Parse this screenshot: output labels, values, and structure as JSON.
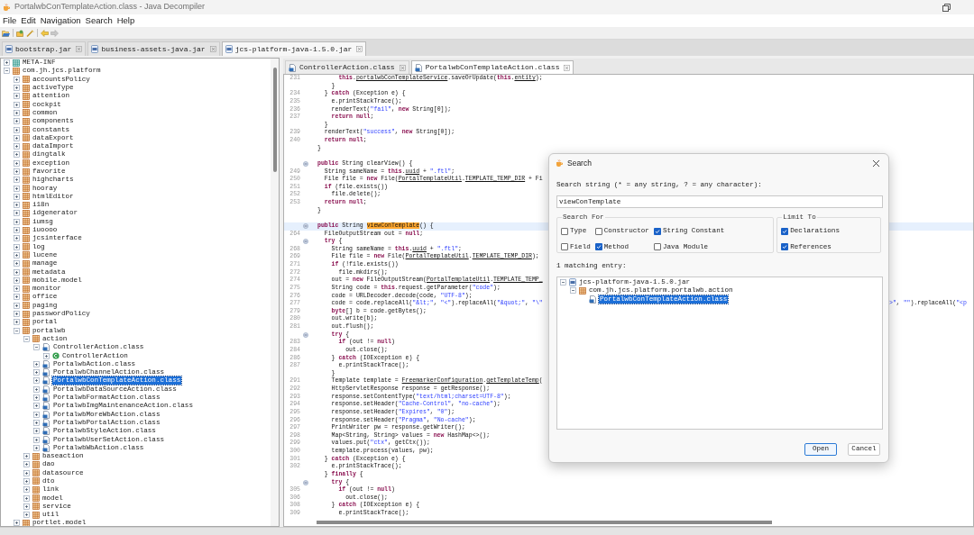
{
  "window": {
    "title": "PortalwbConTemplateAction.class - Java Decompiler"
  },
  "menu": [
    "File",
    "Edit",
    "Navigation",
    "Search",
    "Help"
  ],
  "toolbar": {
    "back_disabled": false,
    "forward_disabled": true
  },
  "jar_tabs": [
    {
      "label": "bootstrap.jar",
      "selected": false
    },
    {
      "label": "business-assets-java.jar",
      "selected": false
    },
    {
      "label": "jcs-platform-java-1.5.0.jar",
      "selected": true
    }
  ],
  "tree": [
    {
      "label": "META-INF",
      "kind": "folder",
      "expanded": false,
      "selected": false
    },
    {
      "label": "com.jh.jcs.platform",
      "kind": "package",
      "expanded": true,
      "selected": false,
      "children": [
        {
          "label": "accountsPolicy",
          "kind": "package",
          "expanded": false,
          "selected": false
        },
        {
          "label": "activeType",
          "kind": "package",
          "expanded": false,
          "selected": false
        },
        {
          "label": "attention",
          "kind": "package",
          "expanded": false,
          "selected": false
        },
        {
          "label": "cockpit",
          "kind": "package",
          "expanded": false,
          "selected": false
        },
        {
          "label": "common",
          "kind": "package",
          "expanded": false,
          "selected": false
        },
        {
          "label": "components",
          "kind": "package",
          "expanded": false,
          "selected": false
        },
        {
          "label": "constants",
          "kind": "package",
          "expanded": false,
          "selected": false
        },
        {
          "label": "dataExport",
          "kind": "package",
          "expanded": false,
          "selected": false
        },
        {
          "label": "dataImport",
          "kind": "package",
          "expanded": false,
          "selected": false
        },
        {
          "label": "dingtalk",
          "kind": "package",
          "expanded": false,
          "selected": false
        },
        {
          "label": "exception",
          "kind": "package",
          "expanded": false,
          "selected": false
        },
        {
          "label": "favorite",
          "kind": "package",
          "expanded": false,
          "selected": false
        },
        {
          "label": "highcharts",
          "kind": "package",
          "expanded": false,
          "selected": false
        },
        {
          "label": "hooray",
          "kind": "package",
          "expanded": false,
          "selected": false
        },
        {
          "label": "htmlEditor",
          "kind": "package",
          "expanded": false,
          "selected": false
        },
        {
          "label": "i18n",
          "kind": "package",
          "expanded": false,
          "selected": false
        },
        {
          "label": "idgenerator",
          "kind": "package",
          "expanded": false,
          "selected": false
        },
        {
          "label": "iumsg",
          "kind": "package",
          "expanded": false,
          "selected": false
        },
        {
          "label": "iuoooo",
          "kind": "package",
          "expanded": false,
          "selected": false
        },
        {
          "label": "jcsinterface",
          "kind": "package",
          "expanded": false,
          "selected": false
        },
        {
          "label": "log",
          "kind": "package",
          "expanded": false,
          "selected": false
        },
        {
          "label": "lucene",
          "kind": "package",
          "expanded": false,
          "selected": false
        },
        {
          "label": "manage",
          "kind": "package",
          "expanded": false,
          "selected": false
        },
        {
          "label": "metadata",
          "kind": "package",
          "expanded": false,
          "selected": false
        },
        {
          "label": "mobile.model",
          "kind": "package",
          "expanded": false,
          "selected": false
        },
        {
          "label": "monitor",
          "kind": "package",
          "expanded": false,
          "selected": false
        },
        {
          "label": "office",
          "kind": "package",
          "expanded": false,
          "selected": false
        },
        {
          "label": "paging",
          "kind": "package",
          "expanded": false,
          "selected": false
        },
        {
          "label": "passwordPolicy",
          "kind": "package",
          "expanded": false,
          "selected": false
        },
        {
          "label": "portal",
          "kind": "package",
          "expanded": false,
          "selected": false
        },
        {
          "label": "portalwb",
          "kind": "package",
          "expanded": true,
          "selected": false,
          "children": [
            {
              "label": "action",
              "kind": "package",
              "expanded": true,
              "selected": false,
              "children": [
                {
                  "label": "ControllerAction.class",
                  "kind": "class",
                  "expanded": true,
                  "selected": false,
                  "children": [
                    {
                      "label": "ControllerAction",
                      "kind": "type",
                      "expanded": false,
                      "selected": false
                    }
                  ]
                },
                {
                  "label": "PortalwbAction.class",
                  "kind": "class",
                  "expanded": false,
                  "selected": false
                },
                {
                  "label": "PortalwbChannelAction.class",
                  "kind": "class",
                  "expanded": false,
                  "selected": false
                },
                {
                  "label": "PortalwbConTemplateAction.class",
                  "kind": "class",
                  "expanded": false,
                  "selected": true
                },
                {
                  "label": "PortalwbDataSourceAction.class",
                  "kind": "class",
                  "expanded": false,
                  "selected": false
                },
                {
                  "label": "PortalwbFormatAction.class",
                  "kind": "class",
                  "expanded": false,
                  "selected": false
                },
                {
                  "label": "PortalwbImgMaintenanceAction.class",
                  "kind": "class",
                  "expanded": false,
                  "selected": false
                },
                {
                  "label": "PortalwbMoreWbAction.class",
                  "kind": "class",
                  "expanded": false,
                  "selected": false
                },
                {
                  "label": "PortalwbPortalAction.class",
                  "kind": "class",
                  "expanded": false,
                  "selected": false
                },
                {
                  "label": "PortalwbStyleAction.class",
                  "kind": "class",
                  "expanded": false,
                  "selected": false
                },
                {
                  "label": "PortalwbUserSetAction.class",
                  "kind": "class",
                  "expanded": false,
                  "selected": false
                },
                {
                  "label": "PortalwbWbAction.class",
                  "kind": "class",
                  "expanded": false,
                  "selected": false
                }
              ]
            },
            {
              "label": "baseaction",
              "kind": "package",
              "expanded": false,
              "selected": false
            },
            {
              "label": "dao",
              "kind": "package",
              "expanded": false,
              "selected": false
            },
            {
              "label": "datasource",
              "kind": "package",
              "expanded": false,
              "selected": false
            },
            {
              "label": "dto",
              "kind": "package",
              "expanded": false,
              "selected": false
            },
            {
              "label": "link",
              "kind": "package",
              "expanded": false,
              "selected": false
            },
            {
              "label": "model",
              "kind": "package",
              "expanded": false,
              "selected": false
            },
            {
              "label": "service",
              "kind": "package",
              "expanded": false,
              "selected": false
            },
            {
              "label": "util",
              "kind": "package",
              "expanded": false,
              "selected": false
            }
          ]
        },
        {
          "label": "portlet.model",
          "kind": "package",
          "expanded": false,
          "selected": false
        }
      ]
    }
  ],
  "editor_tabs": [
    {
      "label": "ControllerAction.class",
      "selected": false
    },
    {
      "label": "PortalwbConTemplateAction.class",
      "selected": true
    }
  ],
  "code": [
    {
      "number": "231",
      "fold": false,
      "current": false,
      "parts": [
        {
          "text": "      this",
          "kind": "keyword"
        },
        {
          "text": "."
        },
        {
          "text": "portalwbConTemplateService",
          "kind": "reference"
        },
        {
          "text": ".saveOrUpdate("
        },
        {
          "text": "this",
          "kind": "keyword"
        },
        {
          "text": "."
        },
        {
          "text": "entity",
          "kind": "reference"
        },
        {
          "text": ");"
        }
      ]
    },
    {
      "fold": false,
      "current": false,
      "parts": [
        {
          "text": "    }"
        }
      ]
    },
    {
      "number": "234",
      "fold": false,
      "current": false,
      "parts": [
        {
          "text": "  } "
        },
        {
          "text": "catch",
          "kind": "keyword"
        },
        {
          "text": " (Exception e) {"
        }
      ]
    },
    {
      "number": "235",
      "fold": false,
      "current": false,
      "parts": [
        {
          "text": "    e.printStackTrace();"
        }
      ]
    },
    {
      "number": "236",
      "fold": false,
      "current": false,
      "parts": [
        {
          "text": "    renderText("
        },
        {
          "text": "\"fail\"",
          "kind": "string"
        },
        {
          "text": ", "
        },
        {
          "text": "new",
          "kind": "keyword"
        },
        {
          "text": " String[0]);"
        }
      ]
    },
    {
      "number": "237",
      "fold": false,
      "current": false,
      "parts": [
        {
          "text": "    return null",
          "kind": "keyword"
        },
        {
          "text": ";"
        }
      ]
    },
    {
      "fold": false,
      "current": false,
      "parts": [
        {
          "text": "  }"
        }
      ]
    },
    {
      "number": "239",
      "fold": false,
      "current": false,
      "parts": [
        {
          "text": "  renderText("
        },
        {
          "text": "\"success\"",
          "kind": "string"
        },
        {
          "text": ", "
        },
        {
          "text": "new",
          "kind": "keyword"
        },
        {
          "text": " String[0]);"
        }
      ]
    },
    {
      "number": "240",
      "fold": false,
      "current": false,
      "parts": [
        {
          "text": "  return null",
          "kind": "keyword"
        },
        {
          "text": ";"
        }
      ]
    },
    {
      "fold": false,
      "current": false,
      "parts": [
        {
          "text": "}"
        }
      ]
    },
    {
      "fold": false,
      "current": false
    },
    {
      "fold": true,
      "current": false,
      "parts": [
        {
          "text": "public",
          "kind": "keyword"
        },
        {
          "text": " String clearView() {"
        }
      ]
    },
    {
      "number": "249",
      "fold": false,
      "current": false,
      "parts": [
        {
          "text": "  String sameName = "
        },
        {
          "text": "this",
          "kind": "keyword"
        },
        {
          "text": "."
        },
        {
          "text": "uuid",
          "kind": "reference"
        },
        {
          "text": " + "
        },
        {
          "text": "\".ftl\"",
          "kind": "string"
        },
        {
          "text": ";"
        }
      ]
    },
    {
      "number": "250",
      "fold": false,
      "current": false,
      "parts": [
        {
          "text": "  File file = "
        },
        {
          "text": "new",
          "kind": "keyword"
        },
        {
          "text": " File("
        },
        {
          "text": "PortalTemplateUtil",
          "kind": "reference"
        },
        {
          "text": "."
        },
        {
          "text": "TEMPLATE_TEMP_DIR",
          "kind": "reference"
        },
        {
          "text": " + Fi"
        }
      ]
    },
    {
      "number": "251",
      "fold": false,
      "current": false,
      "parts": [
        {
          "text": "  if",
          "kind": "keyword"
        },
        {
          "text": " (file.exists())"
        }
      ]
    },
    {
      "number": "252",
      "fold": false,
      "current": false,
      "parts": [
        {
          "text": "    file.delete();"
        }
      ]
    },
    {
      "number": "253",
      "fold": false,
      "current": false,
      "parts": [
        {
          "text": "  return null",
          "kind": "keyword"
        },
        {
          "text": ";"
        }
      ]
    },
    {
      "fold": false,
      "current": false,
      "parts": [
        {
          "text": "}"
        }
      ]
    },
    {
      "fold": false,
      "current": false
    },
    {
      "fold": true,
      "current": true,
      "parts": [
        {
          "text": "public",
          "kind": "keyword"
        },
        {
          "text": " String "
        },
        {
          "text": "viewConTemplate",
          "kind": "match"
        },
        {
          "text": "() {"
        }
      ]
    },
    {
      "number": "264",
      "fold": false,
      "current": false,
      "parts": [
        {
          "text": "  FileOutputStream out = "
        },
        {
          "text": "null",
          "kind": "keyword"
        },
        {
          "text": ";"
        }
      ]
    },
    {
      "fold": true,
      "current": false,
      "parts": [
        {
          "text": "  try",
          "kind": "keyword"
        },
        {
          "text": " {"
        }
      ]
    },
    {
      "number": "268",
      "fold": false,
      "current": false,
      "parts": [
        {
          "text": "    String sameName = "
        },
        {
          "text": "this",
          "kind": "keyword"
        },
        {
          "text": "."
        },
        {
          "text": "uuid",
          "kind": "reference"
        },
        {
          "text": " + "
        },
        {
          "text": "\".ftl\"",
          "kind": "string"
        },
        {
          "text": ";"
        }
      ]
    },
    {
      "number": "269",
      "fold": false,
      "current": false,
      "parts": [
        {
          "text": "    File file = "
        },
        {
          "text": "new",
          "kind": "keyword"
        },
        {
          "text": " File("
        },
        {
          "text": "PortalTemplateUtil",
          "kind": "reference"
        },
        {
          "text": "."
        },
        {
          "text": "TEMPLATE_TEMP_DIR",
          "kind": "reference"
        },
        {
          "text": ");"
        }
      ]
    },
    {
      "number": "271",
      "fold": false,
      "current": false,
      "parts": [
        {
          "text": "    if",
          "kind": "keyword"
        },
        {
          "text": " (!file.exists())"
        }
      ]
    },
    {
      "number": "272",
      "fold": false,
      "current": false,
      "parts": [
        {
          "text": "      file.mkdirs();"
        }
      ]
    },
    {
      "number": "274",
      "fold": false,
      "current": false,
      "parts": [
        {
          "text": "    out = "
        },
        {
          "text": "new",
          "kind": "keyword"
        },
        {
          "text": " FileOutputStream("
        },
        {
          "text": "PortalTemplateUtil",
          "kind": "reference"
        },
        {
          "text": "."
        },
        {
          "text": "TEMPLATE_TEMP_",
          "kind": "reference"
        }
      ]
    },
    {
      "number": "275",
      "fold": false,
      "current": false,
      "parts": [
        {
          "text": "    String code = "
        },
        {
          "text": "this",
          "kind": "keyword"
        },
        {
          "text": ".request.getParameter("
        },
        {
          "text": "\"code\"",
          "kind": "string"
        },
        {
          "text": ");"
        }
      ]
    },
    {
      "number": "276",
      "fold": false,
      "current": false,
      "parts": [
        {
          "text": "    code = URLDecoder.decode(code, "
        },
        {
          "text": "\"UTF-8\"",
          "kind": "string"
        },
        {
          "text": ");"
        }
      ]
    },
    {
      "number": "277",
      "fold": false,
      "current": false,
      "parts": [
        {
          "text": "    code = code.replaceAll("
        },
        {
          "text": "\"&lt;\"",
          "kind": "string"
        },
        {
          "text": ", "
        },
        {
          "text": "\"<\"",
          "kind": "string"
        },
        {
          "text": ").replaceAll("
        },
        {
          "text": "\"&quot;\"",
          "kind": "string"
        },
        {
          "text": ", "
        },
        {
          "text": "\"\\\"",
          "kind": "string"
        }
      ],
      "tail": [
        {
          "text": ">\"",
          "kind": "string"
        },
        {
          "text": ", "
        },
        {
          "text": "\"\"",
          "kind": "string"
        },
        {
          "text": ").replaceAll("
        },
        {
          "text": "\"<p",
          "kind": "string"
        }
      ]
    },
    {
      "number": "279",
      "fold": false,
      "current": false,
      "parts": [
        {
          "text": "    byte",
          "kind": "keyword"
        },
        {
          "text": "[] b = code.getBytes();"
        }
      ]
    },
    {
      "number": "280",
      "fold": false,
      "current": false,
      "parts": [
        {
          "text": "    out.write(b);"
        }
      ]
    },
    {
      "number": "281",
      "fold": false,
      "current": false,
      "parts": [
        {
          "text": "    out.flush();"
        }
      ]
    },
    {
      "fold": true,
      "current": false,
      "parts": [
        {
          "text": "    try",
          "kind": "keyword"
        },
        {
          "text": " {"
        }
      ]
    },
    {
      "number": "283",
      "fold": false,
      "current": false,
      "parts": [
        {
          "text": "      if",
          "kind": "keyword"
        },
        {
          "text": " (out != "
        },
        {
          "text": "null",
          "kind": "keyword"
        },
        {
          "text": ")"
        }
      ]
    },
    {
      "number": "284",
      "fold": false,
      "current": false,
      "parts": [
        {
          "text": "        out.close();"
        }
      ]
    },
    {
      "number": "286",
      "fold": false,
      "current": false,
      "parts": [
        {
          "text": "    } "
        },
        {
          "text": "catch",
          "kind": "keyword"
        },
        {
          "text": " (IOException e) {"
        }
      ]
    },
    {
      "number": "287",
      "fold": false,
      "current": false,
      "parts": [
        {
          "text": "      e.printStackTrace();"
        }
      ]
    },
    {
      "fold": false,
      "current": false,
      "parts": [
        {
          "text": "    }"
        }
      ]
    },
    {
      "number": "291",
      "fold": false,
      "current": false,
      "parts": [
        {
          "text": "    Template template = "
        },
        {
          "text": "FreemarkerConfiguration",
          "kind": "reference"
        },
        {
          "text": "."
        },
        {
          "text": "getTemplateTemp",
          "kind": "reference"
        },
        {
          "text": "("
        }
      ]
    },
    {
      "number": "292",
      "fold": false,
      "current": false,
      "parts": [
        {
          "text": "    HttpServletResponse response = getResponse();"
        }
      ]
    },
    {
      "number": "293",
      "fold": false,
      "current": false,
      "parts": [
        {
          "text": "    response.setContentType("
        },
        {
          "text": "\"text/html;charset=UTF-8\"",
          "kind": "string"
        },
        {
          "text": ");"
        }
      ]
    },
    {
      "number": "294",
      "fold": false,
      "current": false,
      "parts": [
        {
          "text": "    response.setHeader("
        },
        {
          "text": "\"Cache-Control\"",
          "kind": "string"
        },
        {
          "text": ", "
        },
        {
          "text": "\"no-cache\"",
          "kind": "string"
        },
        {
          "text": ");"
        }
      ]
    },
    {
      "number": "295",
      "fold": false,
      "current": false,
      "parts": [
        {
          "text": "    response.setHeader("
        },
        {
          "text": "\"Expires\"",
          "kind": "string"
        },
        {
          "text": ", "
        },
        {
          "text": "\"0\"",
          "kind": "string"
        },
        {
          "text": ");"
        }
      ]
    },
    {
      "number": "296",
      "fold": false,
      "current": false,
      "parts": [
        {
          "text": "    response.setHeader("
        },
        {
          "text": "\"Pragma\"",
          "kind": "string"
        },
        {
          "text": ", "
        },
        {
          "text": "\"No-cache\"",
          "kind": "string"
        },
        {
          "text": ");"
        }
      ]
    },
    {
      "number": "297",
      "fold": false,
      "current": false,
      "parts": [
        {
          "text": "    PrintWriter pw = response.getWriter();"
        }
      ]
    },
    {
      "number": "298",
      "fold": false,
      "current": false,
      "parts": [
        {
          "text": "    Map<String, String> values = "
        },
        {
          "text": "new",
          "kind": "keyword"
        },
        {
          "text": " HashMap<>();"
        }
      ]
    },
    {
      "number": "299",
      "fold": false,
      "current": false,
      "parts": [
        {
          "text": "    values.put("
        },
        {
          "text": "\"ctx\"",
          "kind": "string"
        },
        {
          "text": ", getCtx());"
        }
      ]
    },
    {
      "number": "300",
      "fold": false,
      "current": false,
      "parts": [
        {
          "text": "    template.process(values, pw);"
        }
      ]
    },
    {
      "number": "301",
      "fold": false,
      "current": false,
      "parts": [
        {
          "text": "  } "
        },
        {
          "text": "catch",
          "kind": "keyword"
        },
        {
          "text": " (Exception e) {"
        }
      ]
    },
    {
      "number": "302",
      "fold": false,
      "current": false,
      "parts": [
        {
          "text": "    e.printStackTrace();"
        }
      ]
    },
    {
      "fold": false,
      "current": false,
      "parts": [
        {
          "text": "  } "
        },
        {
          "text": "finally",
          "kind": "keyword"
        },
        {
          "text": " {"
        }
      ]
    },
    {
      "fold": true,
      "current": false,
      "parts": [
        {
          "text": "    try",
          "kind": "keyword"
        },
        {
          "text": " {"
        }
      ]
    },
    {
      "number": "305",
      "fold": false,
      "current": false,
      "parts": [
        {
          "text": "      if",
          "kind": "keyword"
        },
        {
          "text": " (out != "
        },
        {
          "text": "null",
          "kind": "keyword"
        },
        {
          "text": ")"
        }
      ]
    },
    {
      "number": "306",
      "fold": false,
      "current": false,
      "parts": [
        {
          "text": "        out.close();"
        }
      ]
    },
    {
      "number": "308",
      "fold": false,
      "current": false,
      "parts": [
        {
          "text": "    } "
        },
        {
          "text": "catch",
          "kind": "keyword"
        },
        {
          "text": " (IOException e) {"
        }
      ]
    },
    {
      "number": "309",
      "fold": false,
      "current": false,
      "parts": [
        {
          "text": "      e.printStackTrace();"
        }
      ]
    }
  ],
  "dialog": {
    "title": "Search",
    "prompt": "Search string (* = any string, ? = any character):",
    "value": "viewConTemplate",
    "search_for": {
      "title": "Search For",
      "options": [
        {
          "label": "Type",
          "checked": false
        },
        {
          "label": "Constructor",
          "checked": false
        },
        {
          "label": "String Constant",
          "checked": true
        },
        {
          "label": "Field",
          "checked": false
        },
        {
          "label": "Method",
          "checked": true
        },
        {
          "label": "Java Module",
          "checked": false
        }
      ]
    },
    "limit_to": {
      "title": "Limit To",
      "options": [
        {
          "label": "Declarations",
          "checked": true
        },
        {
          "label": "References",
          "checked": true
        }
      ]
    },
    "result_label": "1 matching entry:",
    "results": [
      {
        "label": "jcs-platform-java-1.5.0.jar",
        "kind": "jar",
        "expanded": true,
        "selected": false,
        "children": [
          {
            "label": "com.jh.jcs.platform.portalwb.action",
            "kind": "package",
            "expanded": true,
            "selected": false,
            "children": [
              {
                "label": "PortalwbConTemplateAction.class",
                "kind": "class",
                "selected": true
              }
            ]
          }
        ]
      }
    ],
    "buttons": [
      {
        "label": "Open",
        "default": true
      },
      {
        "label": "Cancel",
        "default": false
      }
    ]
  }
}
